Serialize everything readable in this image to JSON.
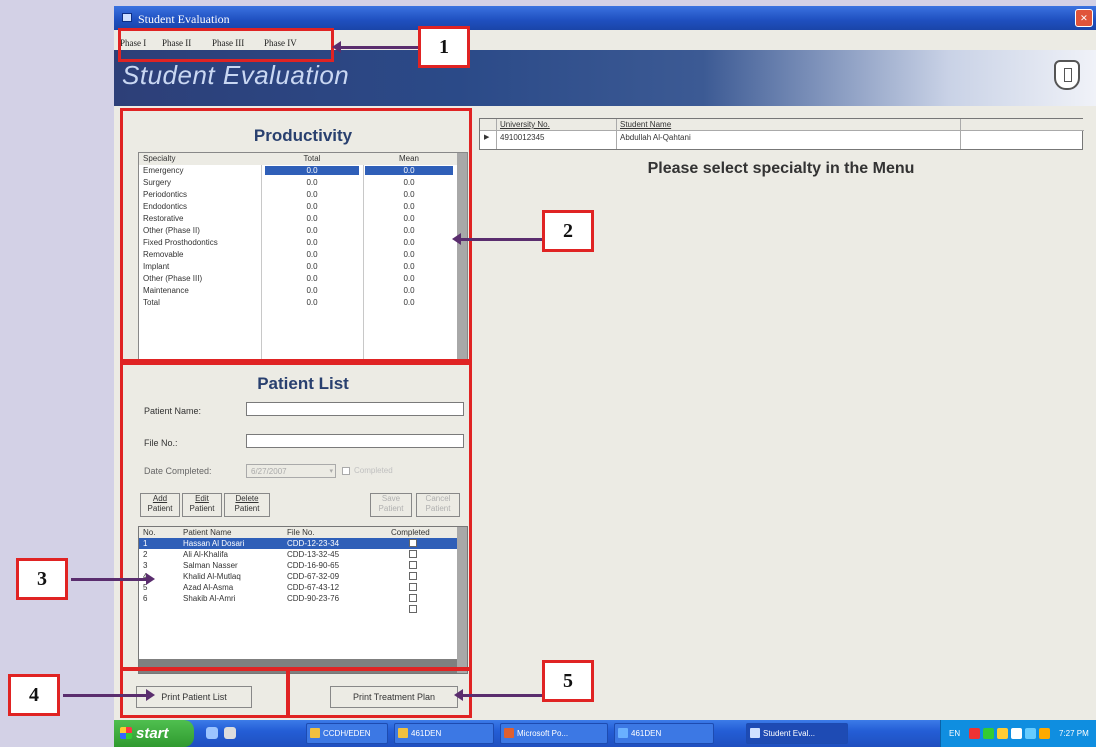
{
  "window": {
    "title": "Student Evaluation",
    "close_glyph": "×"
  },
  "menu": [
    "Phase I",
    "Phase II",
    "Phase III",
    "Phase IV"
  ],
  "banner": {
    "title": "Student Evaluation"
  },
  "student_grid": {
    "headers": [
      "University No.",
      "Student Name"
    ],
    "row": {
      "university_no": "4910012345",
      "name": "Abdullah Al-Qahtani"
    },
    "row_marker": "▶"
  },
  "specialty_message": "Please select specialty in the Menu",
  "productivity": {
    "title": "Productivity",
    "headers": [
      "Specialty",
      "Total",
      "Mean"
    ],
    "rows": [
      {
        "specialty": "Emergency",
        "total": "0.0",
        "mean": "0.0"
      },
      {
        "specialty": "Surgery",
        "total": "0.0",
        "mean": "0.0"
      },
      {
        "specialty": "Periodontics",
        "total": "0.0",
        "mean": "0.0"
      },
      {
        "specialty": "Endodontics",
        "total": "0.0",
        "mean": "0.0"
      },
      {
        "specialty": "Restorative",
        "total": "0.0",
        "mean": "0.0"
      },
      {
        "specialty": "Other (Phase II)",
        "total": "0.0",
        "mean": "0.0"
      },
      {
        "specialty": "Fixed Prosthodontics",
        "total": "0.0",
        "mean": "0.0"
      },
      {
        "specialty": "Removable",
        "total": "0.0",
        "mean": "0.0"
      },
      {
        "specialty": "Implant",
        "total": "0.0",
        "mean": "0.0"
      },
      {
        "specialty": "Other (Phase III)",
        "total": "0.0",
        "mean": "0.0"
      },
      {
        "specialty": "Maintenance",
        "total": "0.0",
        "mean": "0.0"
      },
      {
        "specialty": "Total",
        "total": "0.0",
        "mean": "0.0"
      }
    ]
  },
  "patient_list": {
    "title": "Patient List",
    "name_label": "Patient Name:",
    "file_label": "File No.:",
    "date_label": "Date Completed:",
    "date_value": "6/27/2007",
    "completed_label": "Completed",
    "buttons": {
      "add": [
        "Add",
        "Patient"
      ],
      "edit": [
        "Edit",
        "Patient"
      ],
      "delete": [
        "Delete",
        "Patient"
      ],
      "save": [
        "Save",
        "Patient"
      ],
      "cancel": [
        "Cancel",
        "Patient"
      ]
    },
    "headers": [
      "No.",
      "Patient Name",
      "File No.",
      "Completed"
    ],
    "rows": [
      {
        "no": "1",
        "name": "Hassan Al Dosari",
        "file": "CDD-12-23-34"
      },
      {
        "no": "2",
        "name": "Ali Al-Khalifa",
        "file": "CDD-13-32-45"
      },
      {
        "no": "3",
        "name": "Salman Nasser",
        "file": "CDD-16-90-65"
      },
      {
        "no": "4",
        "name": "Khalid Al-Mutlaq",
        "file": "CDD-67-32-09"
      },
      {
        "no": "5",
        "name": "Azad Al-Asma",
        "file": "CDD-67-43-12"
      },
      {
        "no": "6",
        "name": "Shakib Al-Amri",
        "file": "CDD-90-23-76"
      }
    ],
    "print_list": "Print Patient List",
    "print_plan": "Print Treatment Plan"
  },
  "callouts": [
    "1",
    "2",
    "3",
    "4",
    "5"
  ],
  "taskbar": {
    "start": "start",
    "items": [
      "CCDH/EDEN",
      "461DEN",
      "Microsoft Po...",
      "461DEN",
      "Student Eval..."
    ],
    "lang": "EN",
    "clock": "7:27 PM"
  },
  "colors": {
    "title_bar": "#2a5bd0",
    "selection": "#2f5fb8",
    "annotation": "#e02323",
    "arrow": "#5a2d6e"
  }
}
